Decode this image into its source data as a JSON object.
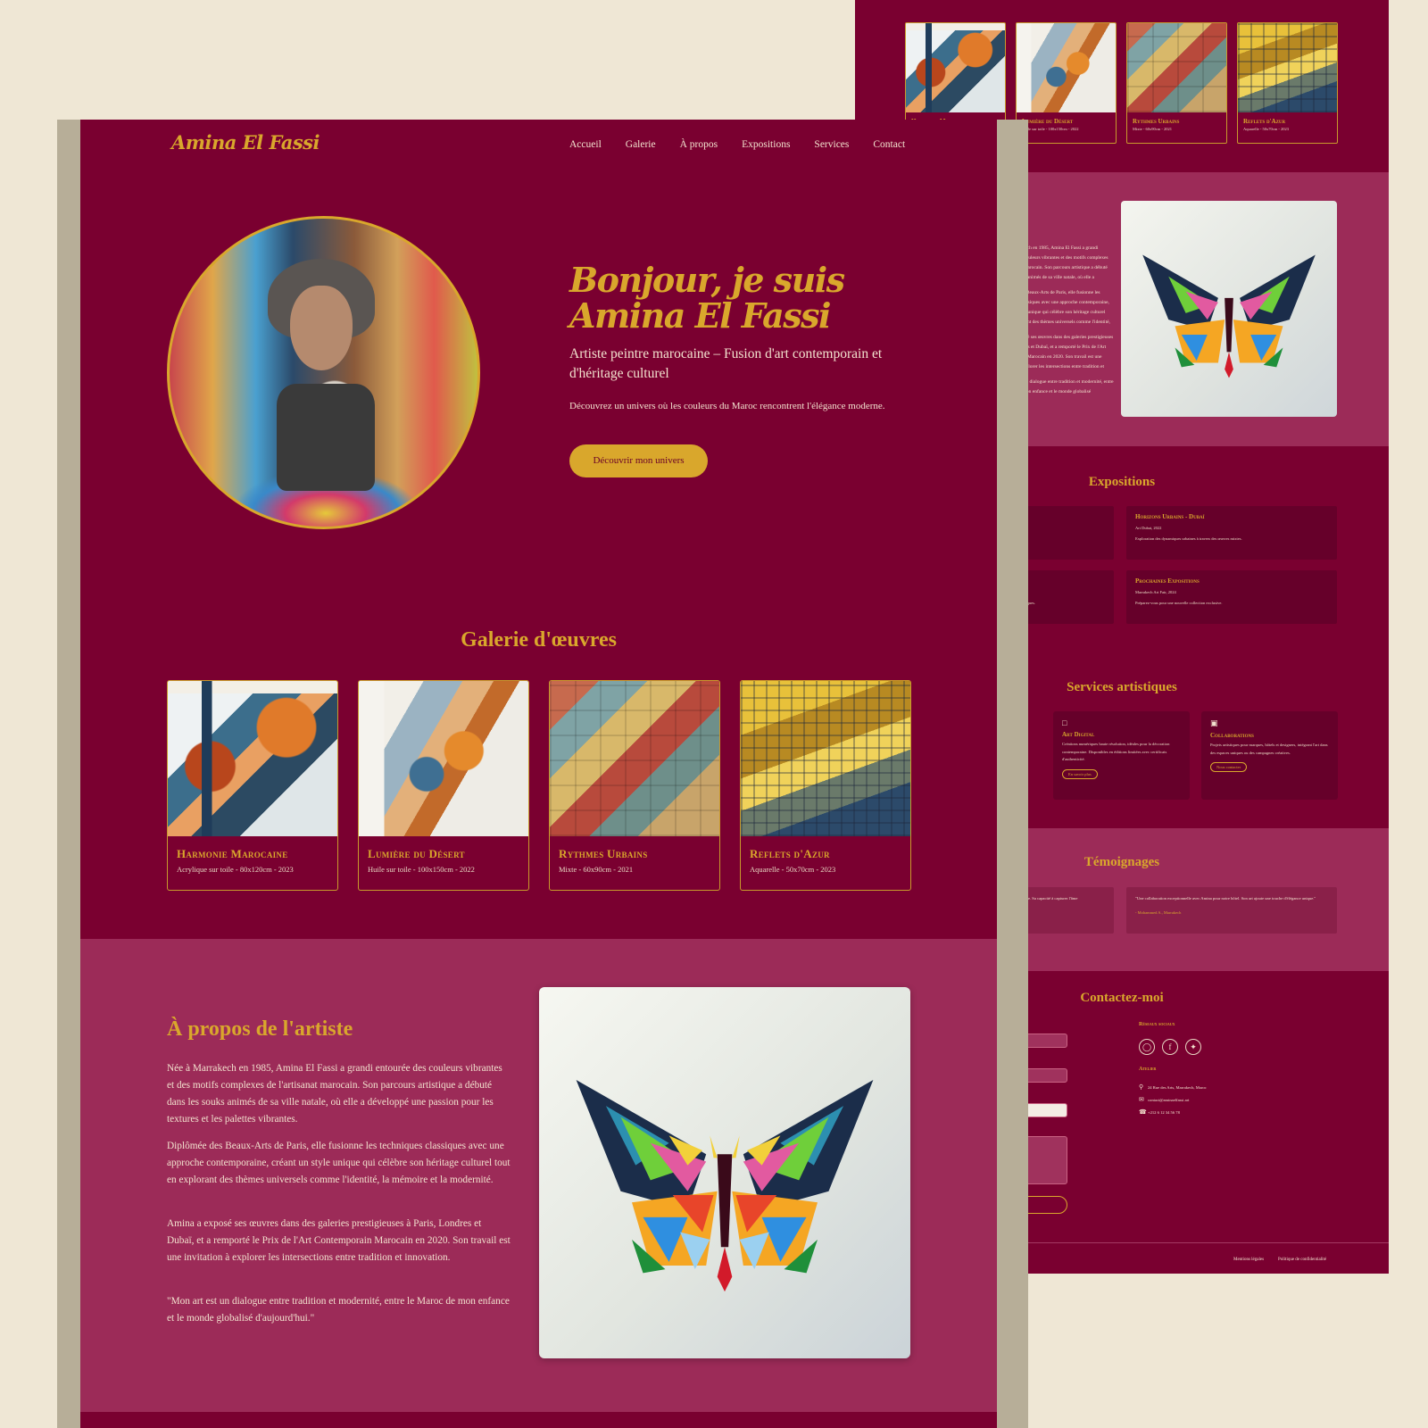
{
  "brand": {
    "name": "Amina El Fassi",
    "primary": "#7a0030",
    "secondary": "#9c2b58",
    "accent": "#d9a72c",
    "cream": "#efe7d5"
  },
  "nav": {
    "items": [
      "Accueil",
      "Galerie",
      "À propos",
      "Expositions",
      "Services",
      "Contact"
    ]
  },
  "hero": {
    "title": "Bonjour, je suis Amina El Fassi",
    "subtitle": "Artiste peintre marocaine – Fusion d'art contemporain et d'héritage culturel",
    "description": "Découvrez un univers où les couleurs du Maroc rencontrent l'élégance moderne.",
    "cta": "Découvrir mon univers"
  },
  "gallery": {
    "title": "Galerie d'œuvres",
    "items": [
      {
        "title": "Harmonie Marocaine",
        "meta": "Acrylique sur toile - 80x120cm - 2023"
      },
      {
        "title": "Lumière du Désert",
        "meta": "Huile sur toile - 100x150cm - 2022"
      },
      {
        "title": "Rythmes Urbains",
        "meta": "Mixte - 60x90cm - 2021"
      },
      {
        "title": "Reflets d'Azur",
        "meta": "Aquarelle - 50x70cm - 2023"
      }
    ]
  },
  "about": {
    "title": "À propos de l'artiste",
    "back_title_fragment": "tiste",
    "paragraphs": [
      "Née à Marrakech en 1985, Amina El Fassi a grandi entourée des couleurs vibrantes et des motifs complexes de l'artisanat marocain. Son parcours artistique a débuté dans les souks animés de sa ville natale, où elle a développé une passion pour les textures et les palettes vibrantes.",
      "Diplômée des Beaux-Arts de Paris, elle fusionne les techniques classiques avec une approche contemporaine, créant un style unique qui célèbre son héritage culturel tout en explorant des thèmes universels comme l'identité, la mémoire et la modernité.",
      "Amina a exposé ses œuvres dans des galeries prestigieuses à Paris, Londres et Dubaï, et a remporté le Prix de l'Art Contemporain Marocain en 2020. Son travail est une invitation à explorer les intersections entre tradition et innovation.",
      "\"Mon art est un dialogue entre tradition et modernité, entre le Maroc de mon enfance et le monde globalisé d'aujourd'hui.\""
    ]
  },
  "expositions": {
    "title": "Expositions",
    "items": [
      {
        "title": "Paris",
        "meta": "",
        "desc": "les influences marocaines dans l'art contemporain."
      },
      {
        "title": "Horizons Urbains - Dubaï",
        "meta": "Art Dubai, 2022",
        "desc": "Exploration des dynamiques urbaines à travers des œuvres mixtes."
      },
      {
        "title": "ondres",
        "meta": "",
        "desc": "uvres numériques."
      },
      {
        "title": "Prochaines Expositions",
        "meta": "Marrakech Art Fair, 2024",
        "desc": "Préparez-vous pour une nouvelle collection exclusive."
      }
    ]
  },
  "services": {
    "title": "Services artistiques",
    "items": [
      {
        "icon": "",
        "title": "",
        "desc": "pons, réalisés modernes.",
        "button": ""
      },
      {
        "icon": "monitor-icon",
        "title": "Art Digital",
        "desc": "Créations numériques haute résolution, idéales pour la décoration contemporaine. Disponibles en éditions limitées avec certificats d'authenticité.",
        "button": "En savoir plus"
      },
      {
        "icon": "briefcase-icon",
        "title": "Collaborations",
        "desc": "Projets artistiques pour marques, hôtels et designers, intégrant l'art dans des espaces uniques ou des campagnes créatives.",
        "button": "Nous contacter"
      }
    ]
  },
  "testimonials": {
    "title": "Témoignages",
    "items": [
      {
        "quote": "son espace de vie. Sa capacité à capturer l'âme",
        "author": ""
      },
      {
        "quote": "\"Une collaboration exceptionnelle avec Amina pour notre hôtel. Son art ajoute une touche d'élégance unique.\"",
        "author": "- Mohammed A., Marrakech"
      }
    ]
  },
  "contact": {
    "title": "Contactez-moi",
    "social_label": "Réseaux sociaux",
    "social_icons": [
      "instagram-icon",
      "facebook-icon",
      "twitter-icon"
    ],
    "atelier_label": "Atelier",
    "address": "24 Rue des Arts, Marrakech, Maroc",
    "email": "contact@aminaelfassi.art",
    "phone": "+212 6 12 34 56 78",
    "submit_fragment": "ssage"
  },
  "footer": {
    "left_fragment": "s.",
    "links": [
      "Mentions légales",
      "Politique de confidentialité"
    ]
  }
}
